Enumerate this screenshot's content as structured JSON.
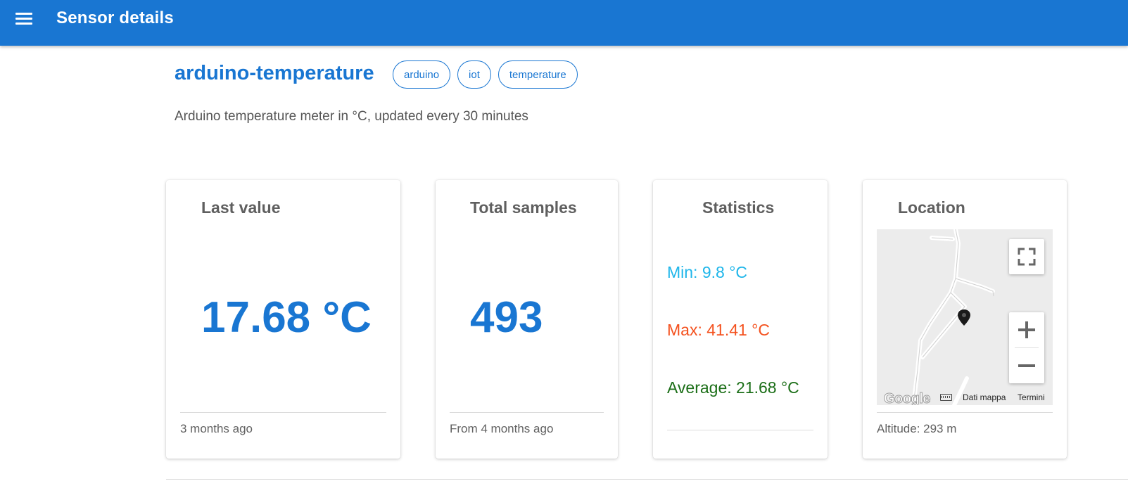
{
  "appbar": {
    "title": "Sensor details",
    "menu_icon": "menu-icon"
  },
  "sensor": {
    "name": "arduino-temperature",
    "tags": [
      "arduino",
      "iot",
      "temperature"
    ],
    "description": "Arduino temperature meter in °C, updated every 30 minutes"
  },
  "cards": {
    "last_value": {
      "title": "Last value",
      "value": "17.68 °C",
      "footer": "3 months ago"
    },
    "total_samples": {
      "title": "Total samples",
      "value": "493",
      "footer": "From 4 months ago"
    },
    "statistics": {
      "title": "Statistics",
      "min": "Min: 9.8 °C",
      "max": "Max: 41.41 °C",
      "average": "Average: 21.68 °C"
    },
    "location": {
      "title": "Location",
      "footer": "Altitude: 293 m",
      "map": {
        "logo": "Google",
        "data_label": "Dati mappa",
        "terms_label": "Termini"
      }
    }
  },
  "colors": {
    "primary": "#1976d2",
    "min": "#1fb6ea",
    "max": "#f4511e",
    "average": "#1b6e17"
  }
}
